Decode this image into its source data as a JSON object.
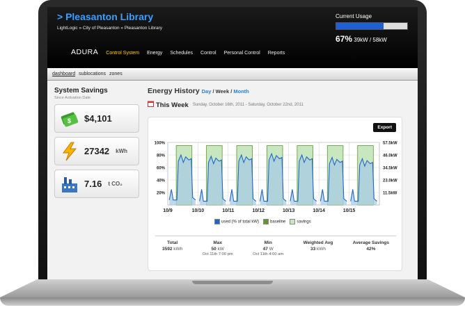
{
  "header": {
    "title": "> Pleasanton Library",
    "breadcrumb": "LightLogic » City of Pleasanton » Pleasanton Library",
    "usage_title": "Current Usage",
    "usage_percent": "67%",
    "usage_detail": "39kW / 58kW",
    "usage_fraction": 0.67
  },
  "nav": {
    "logo": "ADURA",
    "items": [
      "Control System",
      "Energy",
      "Schedules",
      "Control",
      "Personal Control",
      "Reports"
    ]
  },
  "subnav": [
    "dashboard",
    "sublocations",
    "zones"
  ],
  "savings": {
    "title": "System Savings",
    "subtitle": "Since Activation Date",
    "cards": [
      {
        "icon": "money-icon",
        "value": "$4,101",
        "unit": ""
      },
      {
        "icon": "lightning-icon",
        "value": "27342",
        "unit": "kWh"
      },
      {
        "icon": "factory-icon",
        "value": "7.16",
        "unit": "t CO₂"
      }
    ]
  },
  "history": {
    "title": "Energy History",
    "range_links": [
      "Day",
      "Week",
      "Month"
    ],
    "week_label": "This Week",
    "week_range": "Sunday, October 16th, 2011 - Saturday, October 22nd, 2011",
    "export_label": "Export"
  },
  "chart_data": {
    "type": "area",
    "x_ticks": [
      "10/9",
      "10/10",
      "10/11",
      "10/12",
      "10/13",
      "10/14",
      "10/15"
    ],
    "y_ticks_left": [
      "100%",
      "80%",
      "60%",
      "40%",
      "20%"
    ],
    "y_ticks_right": [
      "57.5kW",
      "46.0kW",
      "34.5kW",
      "23.0kW",
      "11.5kW"
    ],
    "ylim": [
      0,
      100
    ],
    "legend": [
      "used (% of total kW)",
      "baseline",
      "savings"
    ],
    "colors": {
      "used": "#2266cc",
      "baseline": "#5c9a2a",
      "savings": "#c8e6c0",
      "used_fill": "#a8cce4"
    },
    "days": [
      {
        "baseline": 95,
        "used": 80,
        "min": 8
      },
      {
        "baseline": 95,
        "used": 78,
        "min": 6
      },
      {
        "baseline": 95,
        "used": 80,
        "min": 6
      },
      {
        "baseline": 95,
        "used": 82,
        "min": 6
      },
      {
        "baseline": 95,
        "used": 80,
        "min": 6
      },
      {
        "baseline": 95,
        "used": 76,
        "min": 6
      },
      {
        "baseline": 95,
        "used": 74,
        "min": 6
      }
    ]
  },
  "stats": [
    {
      "label": "Total",
      "value": "3592",
      "unit": "kWh",
      "sub": ""
    },
    {
      "label": "Max",
      "value": "50",
      "unit": "kW",
      "sub": "Oct 11th 7:00 pm"
    },
    {
      "label": "Min",
      "value": "47",
      "unit": "W",
      "sub": "Oct 11th 4:00 am"
    },
    {
      "label": "Weighted Avg",
      "value": "33",
      "unit": "kWh",
      "sub": ""
    },
    {
      "label": "Average Savings",
      "value": "42%",
      "unit": "",
      "sub": ""
    }
  ]
}
